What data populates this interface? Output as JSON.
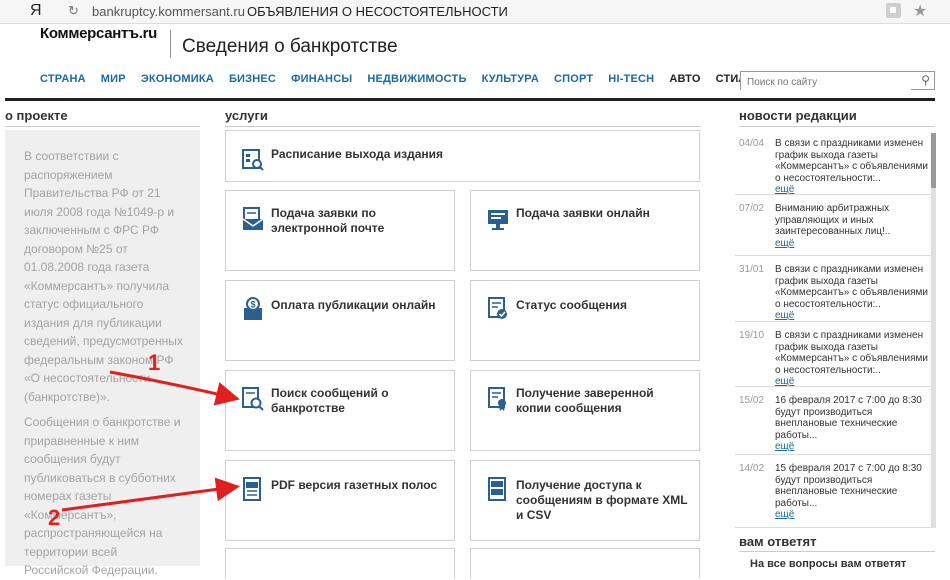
{
  "browser": {
    "yandex": "Я",
    "url": "bankruptcy.kommersant.ru",
    "page_title": "ОБЪЯВЛЕНИЯ О НЕСОСТОЯТЕЛЬНОСТИ"
  },
  "header": {
    "logo": "Коммерсантъ.ru",
    "site_title": "Сведения о банкротстве"
  },
  "nav": {
    "items": [
      "СТРАНА",
      "МИР",
      "ЭКОНОМИКА",
      "БИЗНЕС",
      "ФИНАНСЫ",
      "НЕДВИЖИМОСТЬ",
      "КУЛЬТУРА",
      "СПОРТ",
      "HI-TECH",
      "АВТО",
      "СТИЛЬ"
    ],
    "search_placeholder": "Поиск по сайту"
  },
  "about": {
    "heading": "о проекте",
    "p1": "В соответствии с распоряжением Правительства РФ от 21 июля 2008 года №1049-р и заключенным с ФРС РФ договором №25 от 01.08.2008 года газета «Коммерсантъ» получила статус официального издания для публикации сведений, предусмотренных федеральным законом РФ «О несостоятельности (банкротстве)».",
    "p2": "Сообщения о банкротстве и приравненные к ним сообщения будут публиковаться в субботних номерах газеты «Коммерсантъ», распространяющейся на территории всей Российской Федерации."
  },
  "services": {
    "heading": "услуги",
    "items": [
      "Расписание выхода издания",
      "Подача заявки по электронной почте",
      "Подача заявки онлайн",
      "Оплата публикации онлайн",
      "Статус сообщения",
      "Поиск сообщений о банкротстве",
      "Получение заверенной копии сообщения",
      "PDF версия газетных полос",
      "Получение доступа к сообщениям в формате XML и CSV"
    ]
  },
  "news": {
    "heading": "новости редакции",
    "items": [
      {
        "date": "04/04",
        "text": "В связи с праздниками изменен график выхода газеты «Коммерсантъ» с объявлениями о несостоятельности:..",
        "more": "ещё"
      },
      {
        "date": "07/02",
        "text": "Вниманию арбитражных управляющих и иных заинтересованных лиц!..",
        "more": "ещё"
      },
      {
        "date": "31/01",
        "text": "В связи с праздниками изменен график выхода газеты «Коммерсантъ» с объявлениями о несостоятельности:..",
        "more": "ещё"
      },
      {
        "date": "19/10",
        "text": "В связи с праздниками изменен график выхода газеты «Коммерсантъ» с объявлениями о несостоятельности:..",
        "more": "ещё"
      },
      {
        "date": "15/02",
        "text": "16 февраля 2017 с 7:00 до 8:30 будут производиться внеплановые технические работы...",
        "more": "ещё"
      },
      {
        "date": "14/02",
        "text": "15 февраля 2017 с 7:00 до 8:30 будут производиться внеплановые технические работы...",
        "more": "ещё"
      }
    ]
  },
  "answers": {
    "heading": "вам ответят",
    "teaser": "На все вопросы вам ответят"
  },
  "annotations": [
    "1",
    "2"
  ],
  "colors": {
    "nav_link": "#1a6aa5",
    "icon": "#2a5f8f",
    "arrow": "#e01f1f"
  }
}
